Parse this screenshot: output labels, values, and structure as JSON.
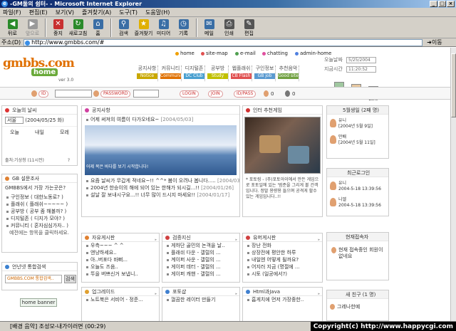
{
  "window": {
    "title": "-GM둘의 쉼터- - Microsoft Internet Explorer"
  },
  "menu": [
    "파일(F)",
    "편집(E)",
    "보기(V)",
    "즐겨찾기(A)",
    "도구(T)",
    "도움말(H)"
  ],
  "toolbar": [
    {
      "label": "뒤로",
      "icon": "back-arrow",
      "color": "#2a8a2a",
      "disabled": false
    },
    {
      "label": "앞으로",
      "icon": "forward-arrow",
      "color": "#9a9a9a",
      "disabled": true
    },
    {
      "label": "중지",
      "icon": "stop",
      "color": "#c83030",
      "disabled": false
    },
    {
      "label": "새로고침",
      "icon": "refresh",
      "color": "#2a8a2a",
      "disabled": false
    },
    {
      "label": "홈",
      "icon": "home",
      "color": "#3a6ea5",
      "disabled": false
    },
    {
      "label": "검색",
      "icon": "search",
      "color": "#3a6ea5",
      "disabled": false
    },
    {
      "label": "즐겨찾기",
      "icon": "star",
      "color": "#e0b000",
      "disabled": false
    },
    {
      "label": "미디어",
      "icon": "media",
      "color": "#3a6ea5",
      "disabled": false
    },
    {
      "label": "기록",
      "icon": "history",
      "color": "#3a6ea5",
      "disabled": false
    },
    {
      "label": "메일",
      "icon": "mail",
      "color": "#3a6ea5",
      "disabled": false
    },
    {
      "label": "인쇄",
      "icon": "print",
      "color": "#555555",
      "disabled": false
    },
    {
      "label": "편집",
      "icon": "edit",
      "color": "#555555",
      "disabled": false
    }
  ],
  "address": {
    "label": "주소(D)",
    "url": "http://www.gmbbs.com/#",
    "go": "이동"
  },
  "site": {
    "logo": "gmbbs.com",
    "logo_sub": "home",
    "version": "ver 3.0",
    "toplinks": [
      {
        "label": "home",
        "color": "#f0a000"
      },
      {
        "label": "site-map",
        "color": "#e05050"
      },
      {
        "label": "e-mail",
        "color": "#50a050"
      },
      {
        "label": "chatting",
        "color": "#e050a0"
      },
      {
        "label": "admin-home",
        "color": "#5080e0"
      }
    ],
    "nav": [
      {
        "k": "공지사항",
        "e": "Notice",
        "color": "#c9a800"
      },
      {
        "k": "커뮤니티",
        "e": "Community",
        "color": "#e07000"
      },
      {
        "k": "디지털존",
        "e": "DC Club",
        "color": "#4aa0d0"
      },
      {
        "k": "공부방",
        "e": "Study",
        "color": "#c0c000"
      },
      {
        "k": "웹플래쉬",
        "e": "CB Flash",
        "color": "#e05050"
      },
      {
        "k": "구인정보",
        "e": "GB job",
        "color": "#5a9ad0"
      },
      {
        "k": "추천음악",
        "e": "Good site",
        "color": "#70a040"
      }
    ],
    "today_label": "오늘날짜",
    "today": "5/25/2004",
    "time_label": "지금시간",
    "time": "11:20:52",
    "right_icons": [
      "Point Rank",
      "Hit Total",
      "Code Zone"
    ]
  },
  "login": {
    "id_label": "ID",
    "pw_label": "PASSWORD",
    "login": "LOGIN",
    "join": "JOIN",
    "idpass": "ID/PASS",
    "count1": "0",
    "count2": "0"
  },
  "weather": {
    "title": "오늘의 날씨",
    "region": "서울",
    "date": "(2004/05/25 화)",
    "cols": [
      "오늘",
      "내일",
      "모레"
    ],
    "footer": "출처:기상청 (11시전)",
    "q": "?"
  },
  "poll": {
    "title": "GB 설문조사",
    "question": "GMBBS에서 가장 가는곳은?",
    "options": [
      "구인정보 ( 대한노동로? )",
      "플래쉬 ( 플래쉬~~~~~ )",
      "공부방 ( 공부 좀 해볼까? )",
      "디지털존 ( 디지가 모야? )",
      "커뮤니티 ( 혼자심심가자.. )"
    ],
    "footer": "예전에는 항목을 클릭하세요."
  },
  "search": {
    "title": "언넌넷 통합검색",
    "banner": "GMBBS.COM 통합검색..",
    "button": "검색",
    "home_banner": "home banner"
  },
  "notice": {
    "title": "공지사항",
    "items": [
      {
        "t": "어제 써져의 여름이 다가오네요~",
        "d": "[2004/05/03]"
      },
      {
        "t": "요즘 날씨가 무갑게 적네요~!! ^^* 붐이 오려나 봅니다.....",
        "d": "[2004/03/11]"
      },
      {
        "t": "2004년 한승이의 해에 되어 있는 한해가 되시길...!!",
        "d": "[2004/01/26]"
      },
      {
        "t": "설날 잘 보내시구요...!! 너무 많이 드시지 마세요!!",
        "d": "[2004/01/17]"
      }
    ],
    "caption": "어제 복은 바다를 보기 시작합니다!"
  },
  "game": {
    "title": "인터 추천게임",
    "desc": "* 포토링 - (주)포토아이에서 만든 게임으로 포토일에 있는 '범준을 그리게 볼 건객입니다. 정말 용량용 들으며 공격게 할수 있는 게임입니다..!!"
  },
  "members": {
    "title": "5월생일 (2째 명)",
    "items": [
      "유니\n[2004년 5월 9일]",
      "만배\n[2004년 5월 11일]"
    ]
  },
  "recent": {
    "title": "최근로그인",
    "items": [
      "유니\n2004-5-18 13:39:56",
      "니엘\n2004-5-18 13:39:56"
    ]
  },
  "visitors": {
    "title": "현재접속자",
    "msg": "현재 접속중인 회원이 없네요"
  },
  "new_member": {
    "title": "새 친구 (1 명)",
    "name": "그레나한예"
  },
  "boards": [
    {
      "title": "자유게시판",
      "items": [
        "우측~~~ ^ ^",
        "앤냥하세요..",
        "아..버포다 바뻐...",
        "오늘도 즈음..",
        "뚜을 버쁘신거 보냅니.."
      ]
    },
    {
      "title": "검증지신",
      "items": [
        "게하단 골민의 논객을 날..",
        "플래쉬 다운 - 갤럴의 ...",
        "계이퍼 사운 - 갤럴의 ...",
        "게이퍼 데터 - 갤럴의 ...",
        "게이퍼 캐핸 - 갤럴의 ..."
      ]
    },
    {
      "title": "유머게시판",
      "items": [
        "장난 전화",
        "상장전에 평안한 하루",
        "내일엔 어떻게 될까요?",
        "어지러 지금 (명절에 ...",
        "시토 (일공에서?)"
      ]
    },
    {
      "title": "업그레이드",
      "items": [
        "노트북은 서비어 - 정준..."
      ]
    },
    {
      "title": "포토샵",
      "items": [
        "껄끔한 레이터 만들기"
      ]
    },
    {
      "title": "Html과Java",
      "items": [
        "흡게치에 먼저 가장중한.."
      ]
    }
  ],
  "status": {
    "text": "[배경 음악] 조성모-내가이러면 (00:29)",
    "copyright": "Copyright(c) http://www.happycgi.com"
  }
}
